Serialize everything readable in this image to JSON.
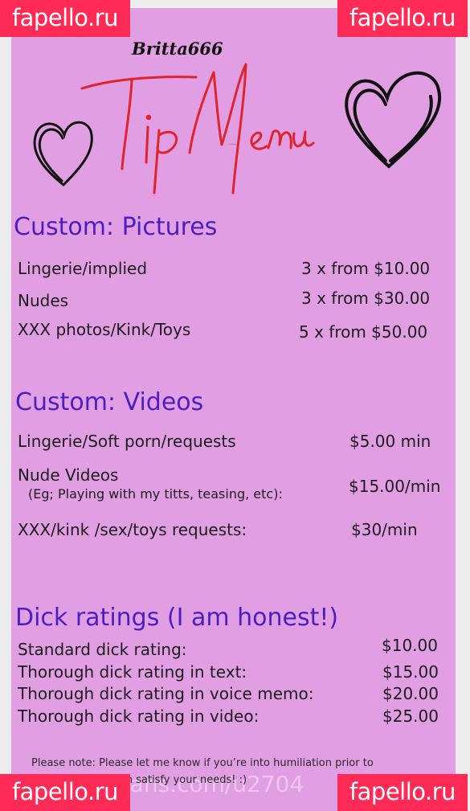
{
  "watermark": "fapello.ru",
  "username": "Britta666",
  "headline": "Tip Menu",
  "colors": {
    "card": "#e19ee3",
    "watermark": "#ff2a55",
    "title": "#4b1fbf",
    "script": "#e0242e"
  },
  "sections": [
    {
      "title": "Custom: Pictures",
      "items": [
        {
          "name": "Lingerie/implied",
          "price": "3 x from $10.00"
        },
        {
          "name": "Nudes",
          "price": "3 x from $30.00"
        },
        {
          "name": "XXX photos/Kink/Toys",
          "price": "5 x from $50.00"
        }
      ]
    },
    {
      "title": "Custom: Videos",
      "items": [
        {
          "name": "Lingerie/Soft porn/requests",
          "price": "$5.00 min"
        },
        {
          "name": "Nude Videos",
          "sub": "(Eg; Playing with my titts, teasing, etc):",
          "price": "$15.00/min"
        },
        {
          "name": "XXX/kink /sex/toys requests:",
          "price": "$30/min"
        }
      ]
    },
    {
      "title": "Dick ratings (I am honest!)",
      "items": [
        {
          "name": "Standard dick rating:",
          "price": "$10.00"
        },
        {
          "name": "Thorough dick rating in text:",
          "price": "$15.00"
        },
        {
          "name": "Thorough dick rating in voice memo:",
          "price": "$20.00"
        },
        {
          "name": "Thorough dick rating in video:",
          "price": "$25.00"
        }
      ]
    }
  ],
  "note_line1": "Please note: Please let me know if you’re into humiliation prior to",
  "note_line2": "purchasing so I can satisfy your needs! :)",
  "faint_url": "OnlyFans.com/u2704"
}
